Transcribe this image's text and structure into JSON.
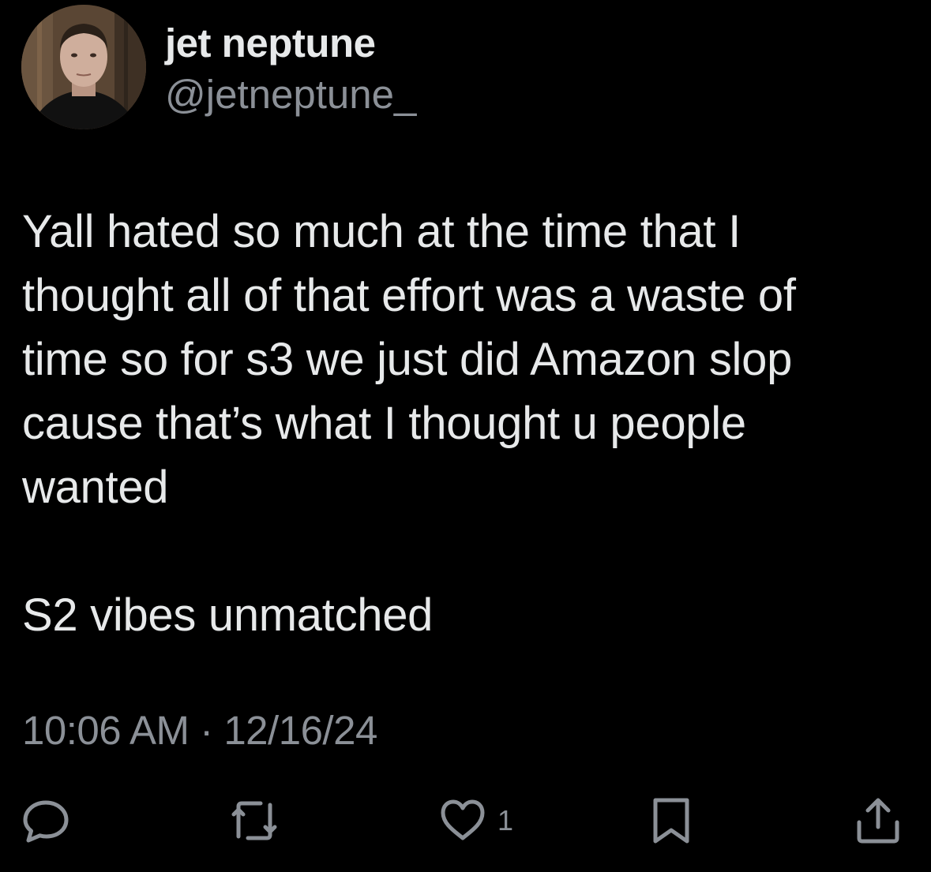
{
  "tweet": {
    "author": {
      "display_name": "jet neptune",
      "handle": "@jetneptune_"
    },
    "text": [
      "Yall hated so much at the time that I\nthought all of that effort was a waste of\ntime so for s3 we just did Amazon slop\ncause that’s what I thought u people\nwanted",
      "S2 vibes unmatched"
    ],
    "time": "10:06 AM",
    "separator": "·",
    "date": "12/16/24",
    "timestamp_text": "10:06 AM · 12/16/24"
  },
  "actions": {
    "reply_icon": "reply-bubble-icon",
    "retweet_icon": "retweet-icon",
    "like_icon": "heart-icon",
    "like_count": "1",
    "bookmark_icon": "bookmark-icon",
    "share_icon": "share-icon"
  },
  "colors": {
    "background": "#000000",
    "text_primary": "#e7e9ea",
    "text_secondary": "#8b9097"
  }
}
